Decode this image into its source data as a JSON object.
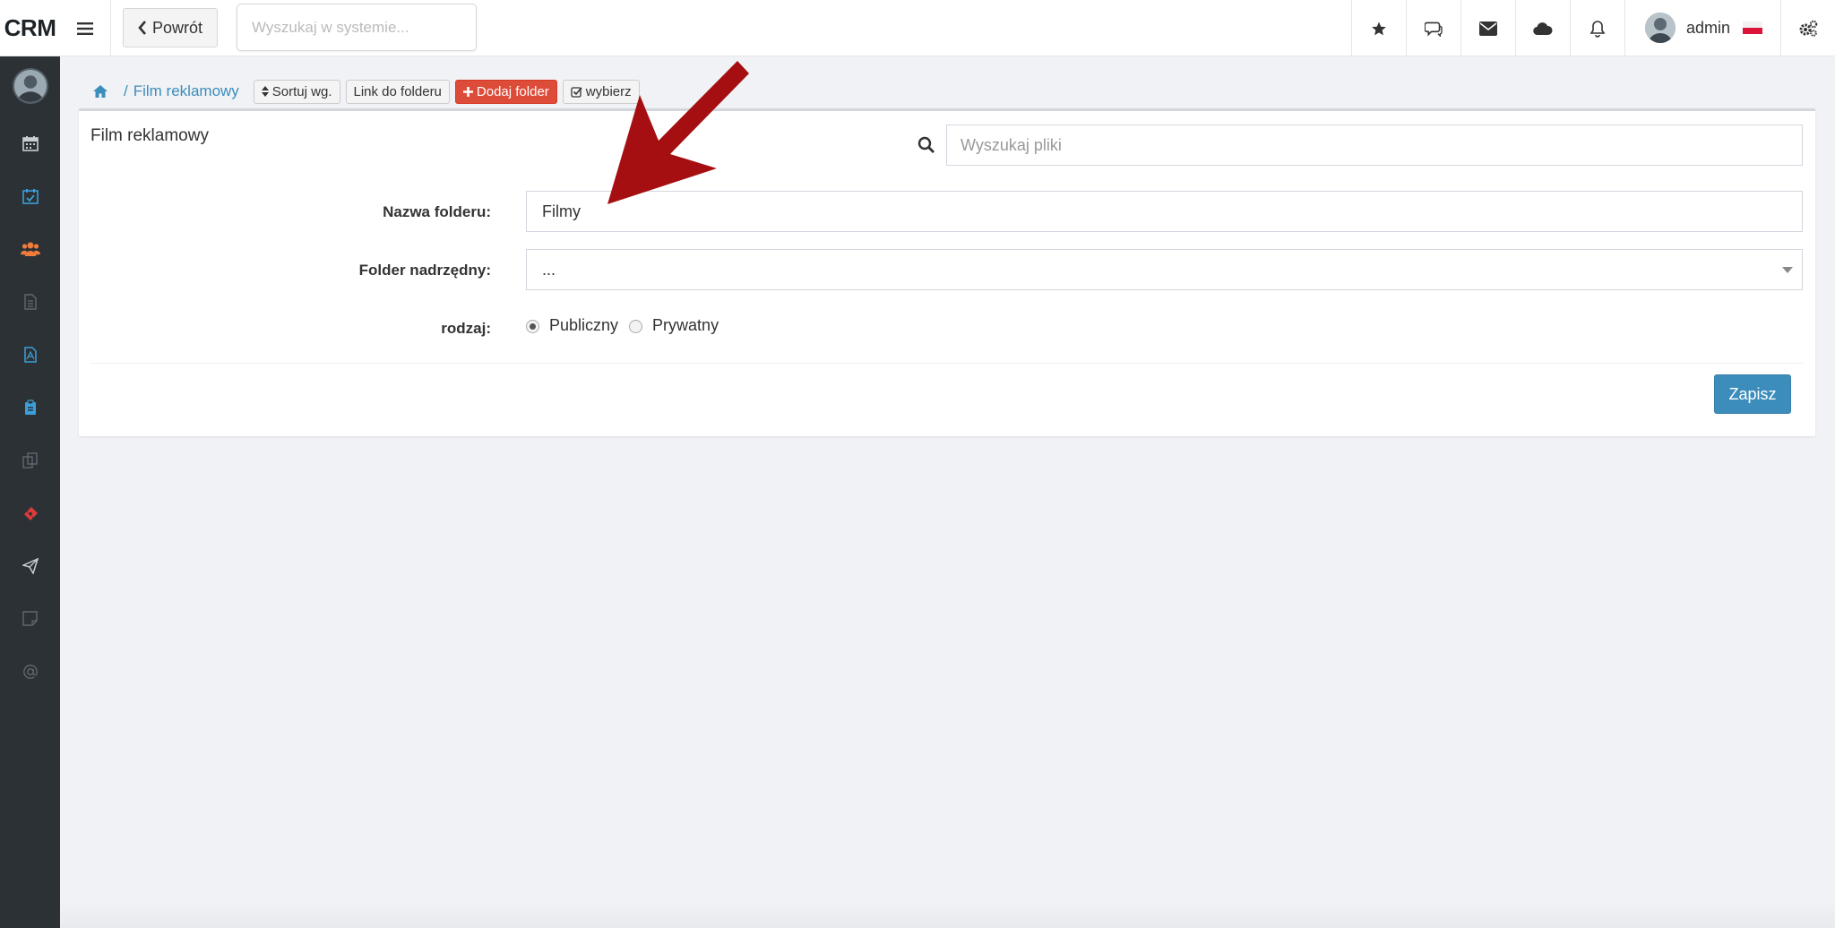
{
  "app": {
    "brand": "CRM"
  },
  "topbar": {
    "back_label": "Powrót",
    "search_placeholder": "Wyszukaj w systemie...",
    "user_name": "admin"
  },
  "breadcrumb": {
    "current": "Film reklamowy",
    "separator": "/"
  },
  "toolbar": {
    "sort_label": "Sortuj wg.",
    "link_label": "Link do folderu",
    "add_folder_label": "Dodaj folder",
    "select_label": "wybierz"
  },
  "panel": {
    "title": "Film reklamowy",
    "file_search_placeholder": "Wyszukaj pliki"
  },
  "form": {
    "folder_name_label": "Nazwa folderu:",
    "folder_name_value": "Filmy",
    "parent_folder_label": "Folder nadrzędny:",
    "parent_folder_value": "...",
    "type_label": "rodzaj:",
    "type_options": [
      "Publiczny",
      "Prywatny"
    ],
    "type_selected": "Publiczny",
    "save_label": "Zapisz"
  },
  "colors": {
    "primary": "#3c8dbc",
    "danger": "#dd4b39",
    "sidebar_bg": "#2c3136",
    "annotation_arrow": "#a50f12"
  }
}
